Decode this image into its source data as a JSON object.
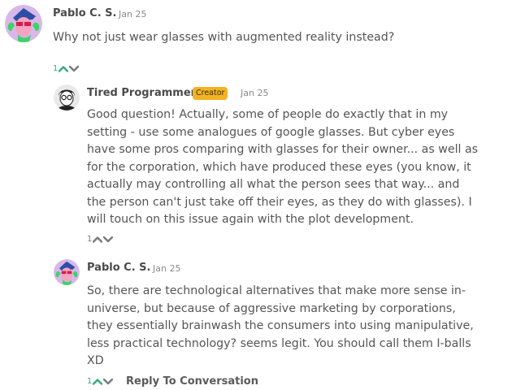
{
  "comments": [
    {
      "author": "Pablo C. S.",
      "date": "Jan 25",
      "text": "Why not just wear glasses with augmented reality instead?",
      "votes": "1"
    },
    {
      "author": "Tired Programmer",
      "badge": "Creator",
      "date": "Jan 25",
      "lines": [
        "Good question! Actually, some of people do exactly that in my",
        "setting - use some analogues of google glasses. But cyber eyes",
        "have some pros comparing with glasses for their owner... as well as",
        "for the corporation, which have produced these eyes (you know, it",
        "actually may controlling all what the person sees that way... and",
        "the person can't just take off their eyes, as they do with glasses). I",
        "will touch on this issue again with the plot development."
      ],
      "votes": "1"
    },
    {
      "author": "Pablo C. S.",
      "date": "Jan 25",
      "lines": [
        "So, there are technological alternatives that make more sense in-",
        "universe, but because of aggressive marketing by corporations,",
        "they essentially brainwash the consumers into using manipulative,",
        "less practical technology? seems legit. You should call them I-balls",
        "XD"
      ],
      "votes": "1"
    }
  ],
  "reply_label": "Reply To Conversation",
  "colors": {
    "upvote_active": "#2eaf75",
    "badge": "#f5b323"
  },
  "icons": [
    "upvote-arrow-icon",
    "downvote-arrow-icon"
  ]
}
